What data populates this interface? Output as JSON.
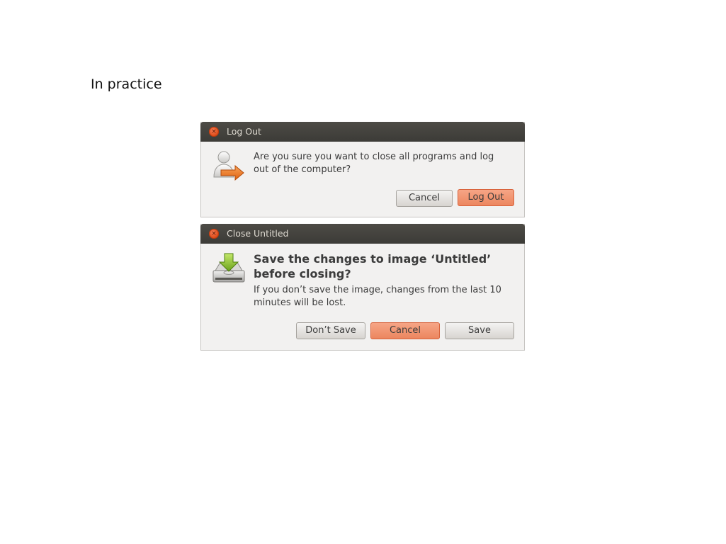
{
  "heading": "In practice",
  "logout_dialog": {
    "title": "Log Out",
    "close_glyph": "×",
    "icon": "user-logout-icon",
    "message": "Are you sure you want to close all programs and log out of the computer?",
    "buttons": {
      "cancel": "Cancel",
      "logout": "Log Out"
    }
  },
  "close_dialog": {
    "title": "Close Untitled",
    "close_glyph": "×",
    "icon": "save-to-disk-icon",
    "primary": "Save the changes to image ‘Untitled’ before closing?",
    "secondary": "If you don’t save the image, changes from the last 10 minutes will be lost.",
    "buttons": {
      "dont_save": "Don’t Save",
      "cancel": "Cancel",
      "save": "Save"
    }
  },
  "colors": {
    "titlebar": "#3c3b37",
    "dialog_bg": "#f2f1f0",
    "default_button": "#ec865f",
    "close_button": "#dd4814"
  }
}
